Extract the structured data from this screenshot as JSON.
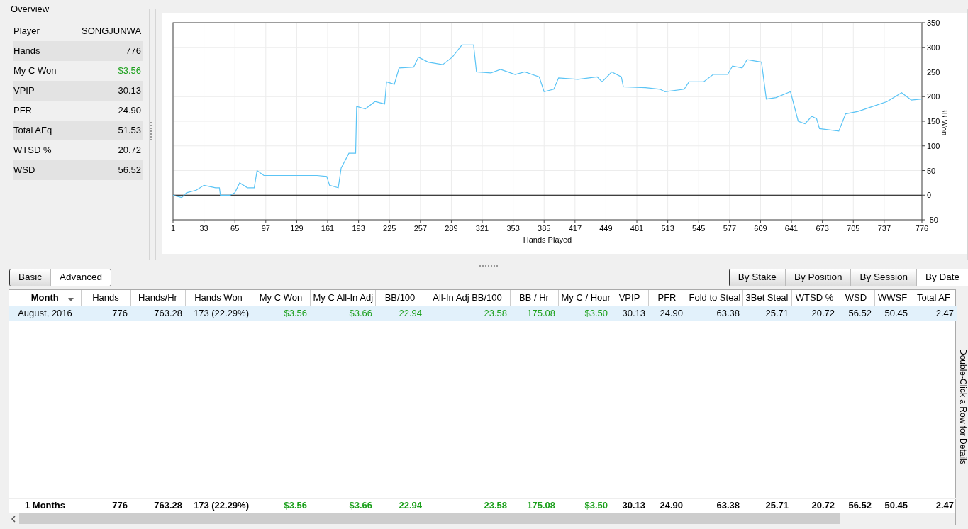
{
  "overview": {
    "title": "Overview",
    "rows": [
      {
        "label": "Player",
        "value": "SONGJUNWA",
        "color": "#000000"
      },
      {
        "label": "Hands",
        "value": "776",
        "color": "#000000"
      },
      {
        "label": "My C Won",
        "value": "$3.56",
        "color": "#1ca01c"
      },
      {
        "label": "VPIP",
        "value": "30.13",
        "color": "#000000"
      },
      {
        "label": "PFR",
        "value": "24.90",
        "color": "#000000"
      },
      {
        "label": "Total AFq",
        "value": "51.53",
        "color": "#000000"
      },
      {
        "label": "WTSD %",
        "value": "20.72",
        "color": "#000000"
      },
      {
        "label": "WSD",
        "value": "56.52",
        "color": "#000000"
      }
    ]
  },
  "graph": {
    "chart_data": {
      "type": "line",
      "xlabel": "Hands Played",
      "ylabel": "BB Won",
      "x": [
        1,
        10,
        15,
        25,
        33,
        45,
        49,
        50,
        60,
        65,
        70,
        78,
        85,
        88,
        95,
        110,
        129,
        150,
        160,
        163,
        172,
        175,
        183,
        190,
        191,
        200,
        210,
        220,
        222,
        230,
        235,
        250,
        255,
        265,
        280,
        290,
        300,
        312,
        315,
        330,
        340,
        355,
        365,
        380,
        385,
        395,
        400,
        420,
        440,
        445,
        455,
        465,
        467,
        490,
        505,
        510,
        530,
        535,
        550,
        560,
        575,
        580,
        590,
        595,
        610,
        615,
        625,
        640,
        648,
        655,
        662,
        667,
        670,
        690,
        697,
        710,
        725,
        740,
        755,
        765,
        776
      ],
      "grid": true,
      "series": [
        {
          "color": "#5bc4f5",
          "values": [
            0,
            -5,
            5,
            10,
            20,
            15,
            15,
            0,
            0,
            5,
            25,
            15,
            15,
            50,
            40,
            40,
            40,
            40,
            38,
            20,
            15,
            55,
            85,
            85,
            180,
            175,
            190,
            185,
            230,
            225,
            258,
            260,
            280,
            270,
            265,
            280,
            305,
            305,
            250,
            248,
            255,
            245,
            250,
            240,
            210,
            215,
            238,
            235,
            240,
            230,
            250,
            240,
            220,
            218,
            215,
            210,
            215,
            230,
            230,
            245,
            245,
            262,
            258,
            275,
            270,
            195,
            198,
            210,
            150,
            145,
            160,
            155,
            135,
            130,
            165,
            170,
            180,
            190,
            208,
            193,
            195
          ]
        }
      ],
      "xlim": [
        1,
        776
      ],
      "ylim": [
        -50,
        350
      ],
      "xticks": [
        1,
        33,
        65,
        97,
        129,
        161,
        193,
        225,
        257,
        289,
        321,
        353,
        385,
        417,
        449,
        481,
        513,
        545,
        577,
        609,
        641,
        673,
        705,
        737,
        776
      ],
      "yticks": [
        -50,
        0,
        50,
        100,
        150,
        200,
        250,
        300,
        350
      ]
    }
  },
  "view_tabs": [
    {
      "label": "Basic",
      "selected": false
    },
    {
      "label": "Advanced",
      "selected": true
    }
  ],
  "group_tabs": [
    {
      "label": "By Stake",
      "selected": false
    },
    {
      "label": "By Position",
      "selected": false
    },
    {
      "label": "By Session",
      "selected": false
    },
    {
      "label": "By Date",
      "selected": true
    }
  ],
  "table": {
    "columns": [
      {
        "label": "Month",
        "color": "#000000",
        "sorted": true
      },
      {
        "label": "Hands",
        "color": "#000000"
      },
      {
        "label": "Hands/Hr",
        "color": "#000000"
      },
      {
        "label": "Hands Won",
        "color": "#000000"
      },
      {
        "label": "My C Won",
        "color": "#1ca01c"
      },
      {
        "label": "My C All-In Adj",
        "color": "#1ca01c"
      },
      {
        "label": "BB/100",
        "color": "#1ca01c"
      },
      {
        "label": "All-In Adj BB/100",
        "color": "#1ca01c"
      },
      {
        "label": "BB / Hr",
        "color": "#1ca01c"
      },
      {
        "label": "My C / Hour",
        "color": "#1ca01c"
      },
      {
        "label": "VPIP",
        "color": "#000000"
      },
      {
        "label": "PFR",
        "color": "#000000"
      },
      {
        "label": "Fold to Steal",
        "color": "#000000"
      },
      {
        "label": "3Bet Steal",
        "color": "#000000"
      },
      {
        "label": "WTSD %",
        "color": "#000000"
      },
      {
        "label": "WSD",
        "color": "#000000"
      },
      {
        "label": "WWSF",
        "color": "#000000"
      },
      {
        "label": "Total AF",
        "color": "#000000"
      }
    ],
    "rows": [
      {
        "selected": true,
        "cells": [
          "August, 2016",
          "776",
          "763.28",
          "173 (22.29%)",
          "$3.56",
          "$3.66",
          "22.94",
          "23.58",
          "175.08",
          "$3.50",
          "30.13",
          "24.90",
          "63.38",
          "25.71",
          "20.72",
          "56.52",
          "50.45",
          "2.47"
        ]
      }
    ],
    "totals": [
      "1 Months",
      "776",
      "763.28",
      "173 (22.29%)",
      "$3.56",
      "$3.66",
      "22.94",
      "23.58",
      "175.08",
      "$3.50",
      "30.13",
      "24.90",
      "63.38",
      "25.71",
      "20.72",
      "56.52",
      "50.45",
      "2.47"
    ]
  },
  "side_hint": "Double-Click a Row for Details"
}
